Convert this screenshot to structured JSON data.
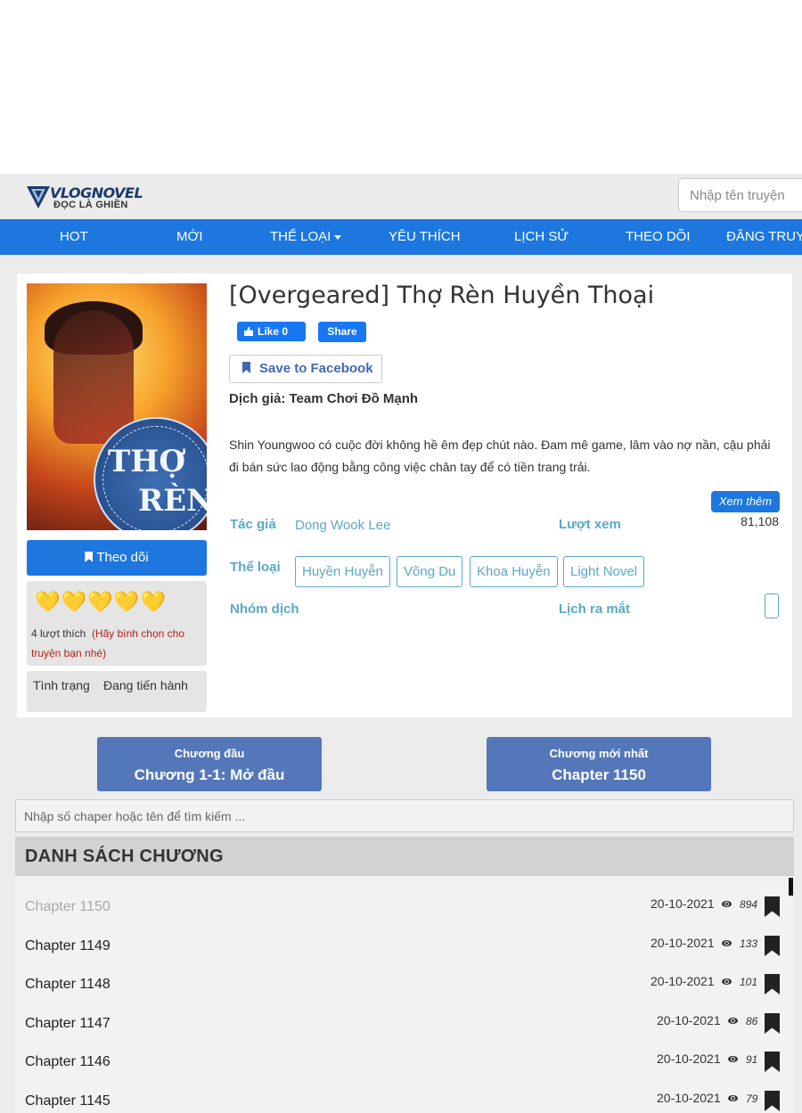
{
  "site": {
    "logo_title": "VLOGNOVEL",
    "logo_subtitle": "ĐỌC LÀ GHIỀN",
    "search_placeholder": "Nhập tên truyện"
  },
  "nav": {
    "items": [
      "HOT",
      "MỚI",
      "THỂ LOẠI",
      "YÊU THÍCH",
      "LỊCH SỬ",
      "THEO DÕI",
      "ĐĂNG TRUYỆN"
    ]
  },
  "novel": {
    "title": "[Overgeared] Thợ Rèn Huyền Thoại",
    "cover_text_1": "THỢ",
    "cover_text_2": "RÈN",
    "fb_like": "Like 0",
    "fb_share": "Share",
    "save_facebook": "Save to Facebook",
    "translator": "Dịch giả: Team Chơi Đồ Mạnh",
    "description": "Shin Youngwoo có cuộc đời không hề êm đẹp chút nào. Đam mê game, lâm vào nợ nần, cậu phải đi bán sức lao động bằng công việc chân tay để có tiền trang trải.",
    "more_label": "Xem thêm",
    "author_label": "Tác giả",
    "author": "Dong Wook Lee",
    "views_label": "Lượt xem",
    "views": "81,108",
    "genre_label": "Thể loại",
    "genres": [
      "Huyền Huyễn",
      "Võng Du",
      "Khoa Huyễn",
      "Light Novel"
    ],
    "group_label": "Nhóm dịch",
    "release_label": "Lịch ra mắt"
  },
  "sidebar": {
    "follow_label": "Theo dõi",
    "hearts": "💛💛💛💛💛",
    "rating_score": 5,
    "likes_text": "4 lượt thích",
    "likes_note": "(Hãy bình chọn cho truyện bạn nhé)",
    "status_label": "Tình trạng",
    "status_value": "Đang tiến hành"
  },
  "buttons": {
    "first_small": "Chương đầu",
    "first_big": "Chương 1-1: Mở đầu",
    "latest_small": "Chương mới nhất",
    "latest_big": "Chapter 1150"
  },
  "chapters": {
    "search_placeholder": "Nhập số chaper hoặc tên để tìm kiếm ...",
    "header": "DANH SÁCH CHƯƠNG",
    "rows": [
      {
        "name": "Chapter 1150",
        "date": "20-10-2021",
        "views": "894"
      },
      {
        "name": "Chapter 1149",
        "date": "20-10-2021",
        "views": "133"
      },
      {
        "name": "Chapter 1148",
        "date": "20-10-2021",
        "views": "101"
      },
      {
        "name": "Chapter 1147",
        "date": "20-10-2021",
        "views": "86"
      },
      {
        "name": "Chapter 1146",
        "date": "20-10-2021",
        "views": "91"
      },
      {
        "name": "Chapter 1145",
        "date": "20-10-2021",
        "views": "79"
      }
    ]
  },
  "colors": {
    "nav_blue": "#1d77df",
    "teal_label": "#5aa8c8",
    "chapter_button": "#5477ba",
    "heart": "#f4b21a"
  }
}
